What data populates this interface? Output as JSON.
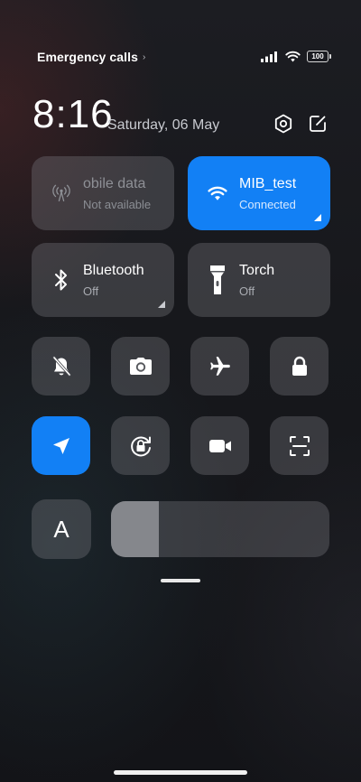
{
  "status_bar": {
    "carrier_text": "Emergency calls",
    "battery": "100"
  },
  "header": {
    "time": "8:16",
    "date": "Saturday, 06 May"
  },
  "tiles": {
    "mobile_data": {
      "title": "obile data",
      "subtitle": "Not available",
      "icon": "antenna-icon",
      "state": "disabled"
    },
    "wifi": {
      "title": "MIB_test",
      "subtitle": "Connected",
      "icon": "wifi-icon",
      "state": "on"
    },
    "bluetooth": {
      "title": "Bluetooth",
      "subtitle": "Off",
      "icon": "bluetooth-icon",
      "state": "off"
    },
    "torch": {
      "title": "Torch",
      "subtitle": "Off",
      "icon": "flashlight-icon",
      "state": "off"
    }
  },
  "toggles": [
    {
      "name": "silent",
      "icon": "bell-off-icon",
      "state": "off"
    },
    {
      "name": "screenshot",
      "icon": "camera-icon",
      "state": "off"
    },
    {
      "name": "airplane",
      "icon": "airplane-icon",
      "state": "off"
    },
    {
      "name": "lock-screen",
      "icon": "lock-icon",
      "state": "off"
    },
    {
      "name": "location",
      "icon": "location-arrow-icon",
      "state": "on"
    },
    {
      "name": "rotation-lock",
      "icon": "rotation-lock-icon",
      "state": "off"
    },
    {
      "name": "screen-recorder",
      "icon": "video-camera-icon",
      "state": "off"
    },
    {
      "name": "scanner",
      "icon": "scan-icon",
      "state": "off"
    }
  ],
  "brightness": {
    "auto_label": "A",
    "level": 0.22
  },
  "colors": {
    "accent": "#1280f5",
    "tile": "#4a4b50"
  }
}
